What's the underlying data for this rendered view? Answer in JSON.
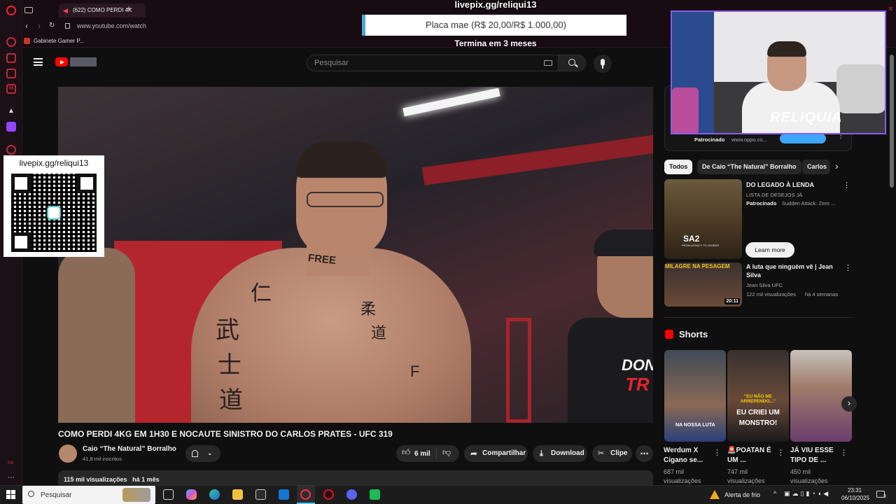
{
  "browser": {
    "tab_title": "(622) COMO PERDI 4K",
    "url": "www.youtube.com/watch",
    "bookmark": "Gabinete Gamer P..."
  },
  "youtube": {
    "search_placeholder": "Pesquisar",
    "video": {
      "title": "COMO PERDI 4KG EM 1H30 E NOCAUTE SINISTRO DO CARLOS PRATES - UFC 319",
      "channel": "Caio “The Natural” Borralho",
      "subscribers": "41,8 mil inscritos",
      "likes": "6 mil",
      "share": "Compartilhar",
      "download": "Download",
      "clip": "Clipe",
      "views": "115 mil visualizações",
      "age": "há 1 mês",
      "tattoos": [
        "FREE",
        "仁",
        "柔",
        "道",
        "武",
        "士",
        "道",
        "F"
      ],
      "shirt_text": [
        "DON",
        "TR"
      ]
    },
    "sidebar": {
      "sponsor_top": "Patrocinado",
      "sponsor_top_url": "www.oppo.co...",
      "chips": [
        "Todos",
        "De Caio “The Natural” Borralho",
        "Carlos"
      ],
      "ad": {
        "title": "DO LEGADO À LENDA",
        "subtitle": "LISTA DE DESEJOS JÁ",
        "sponsor": "Patrocinado",
        "advertiser": "Sudden Attack: Zero ...",
        "cta": "Learn more",
        "thumb_logo": "SA2",
        "thumb_tagline": "FROM LEGACY TO LEGEND"
      },
      "rec": {
        "title": "A luta que ninguém vê | Jean Silva",
        "channel": "Jean Silva UFC",
        "views": "122 mil visualizações",
        "age": "há 4 semanas",
        "duration": "20:11",
        "thumb_text": "MILAGRE NA PESAGEM"
      },
      "shorts_header": "Shorts",
      "shorts": [
        {
          "title": "Werdum X Cigano se...",
          "views": "687 mil",
          "views_label": "visualizações",
          "thumb_text": [
            "NA NOSSA LUTA"
          ]
        },
        {
          "title": "🚨POATAN É UM ...",
          "views": "747 mil",
          "views_label": "visualizações",
          "thumb_text": [
            "\"EU NÃO ME ARREPENDO...\"",
            "EU CRIEI UM",
            "MONSTRO!"
          ]
        },
        {
          "title": "JÁ VIU ESSE TIPO DE ...",
          "views": "450 mil",
          "views_label": "visualizações",
          "thumb_text": []
        }
      ]
    }
  },
  "overlays": {
    "livepix_top": "livepix.gg/reliqui13",
    "livepix_qr": "livepix.gg/reliqui13",
    "donation_bar": "Placa mae (R$ 20,00/R$ 1.000,00)",
    "donation_end": "Termina em 3 meses",
    "webcam_watermark": "RELIQUIA"
  },
  "taskbar": {
    "search": "Pesquisar",
    "weather": "Alerta de frio",
    "time": "23:31",
    "date": "06/10/2025",
    "notifications": "3"
  },
  "colors": {
    "youtube_red": "#ff0000",
    "opera_red": "#ff1b2d",
    "webcam_border": "#8a5cf0",
    "donation_accent": "#49a8d6"
  }
}
